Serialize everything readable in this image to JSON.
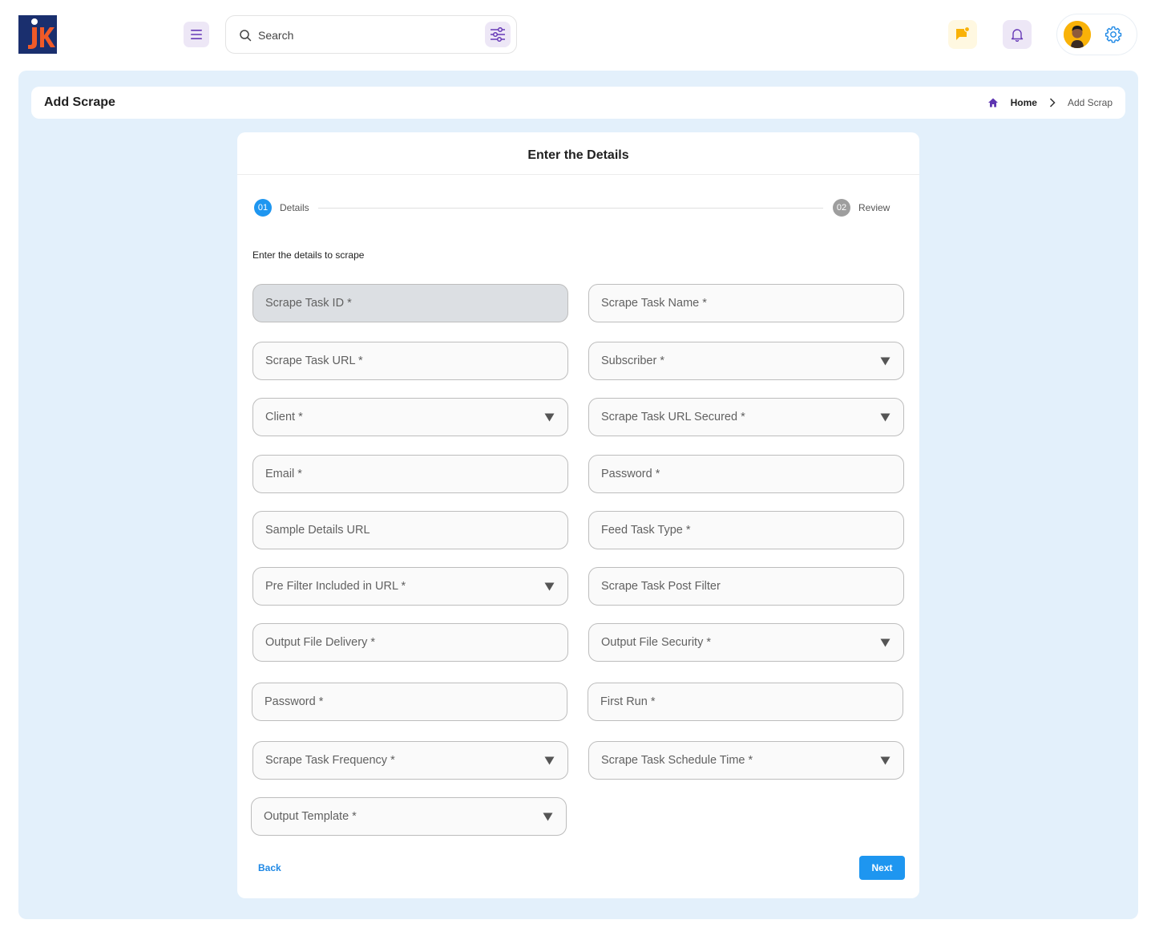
{
  "header": {
    "logo_alt": "JK",
    "search": {
      "placeholder": "Search"
    }
  },
  "page": {
    "title": "Add Scrape",
    "breadcrumb": {
      "home": "Home",
      "current": "Add Scrap"
    }
  },
  "form": {
    "title": "Enter the Details",
    "steps": [
      {
        "number": "01",
        "label": "Details",
        "active": true
      },
      {
        "number": "02",
        "label": "Review",
        "active": false
      }
    ],
    "subheading": "Enter the details to scrape",
    "fields": [
      {
        "label": "Scrape Task ID *",
        "type": "text",
        "disabled": true
      },
      {
        "label": "Scrape Task Name *",
        "type": "text"
      },
      {
        "label": "Scrape Task URL *",
        "type": "text"
      },
      {
        "label": "Subscriber *",
        "type": "select"
      },
      {
        "label": "Client *",
        "type": "select"
      },
      {
        "label": "Scrape Task URL Secured *",
        "type": "select"
      },
      {
        "label": "Email *",
        "type": "text"
      },
      {
        "label": "Password *",
        "type": "text"
      },
      {
        "label": "Sample Details URL",
        "type": "text"
      },
      {
        "label": "Feed Task Type *",
        "type": "text"
      },
      {
        "label": "Pre Filter Included in URL *",
        "type": "select"
      },
      {
        "label": "Scrape Task Post Filter",
        "type": "text"
      },
      {
        "label": "Output File Delivery *",
        "type": "text"
      },
      {
        "label": "Output File Security *",
        "type": "select"
      },
      {
        "label": "Password *",
        "type": "text"
      },
      {
        "label": "First Run *",
        "type": "text"
      },
      {
        "label": "Scrape Task Frequency *",
        "type": "select"
      },
      {
        "label": "Scrape Task Schedule Time *",
        "type": "select"
      },
      {
        "label": "Output Template *",
        "type": "select"
      }
    ],
    "back_label": "Back",
    "next_label": "Next"
  },
  "colors": {
    "accent": "#1e96f0",
    "main_bg": "#e3f0fb",
    "disabled_field": "#dcdfe3",
    "step_active": "#1e96f0",
    "step_inactive": "#9e9e9e"
  },
  "icons": [
    "menu-icon",
    "search-icon",
    "filter-icon",
    "message-icon",
    "bell-icon",
    "gear-icon",
    "home-icon",
    "chevron-right-icon",
    "caret-down-icon"
  ]
}
